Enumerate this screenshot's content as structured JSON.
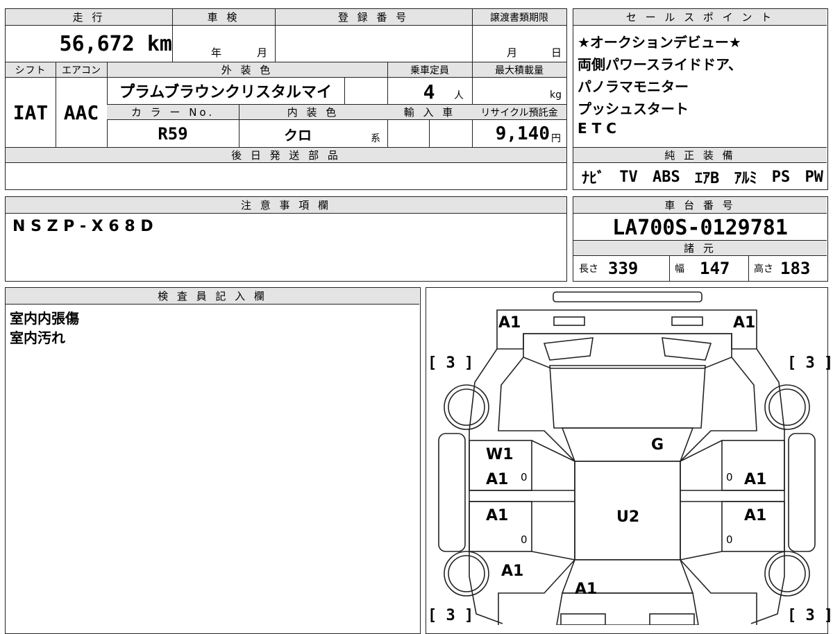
{
  "vehicle": {
    "mileage_header": "走 行",
    "mileage_value": "56,672 km",
    "inspection_header": "車 検",
    "inspection_year": "年",
    "inspection_month": "月",
    "registration_header": "登 録 番 号",
    "transfer_header": "譲渡書類期限",
    "transfer_month": "月",
    "transfer_day": "日",
    "shift_header": "シフト",
    "shift_value": "IAT",
    "ac_header": "エアコン",
    "ac_value": "AAC",
    "exterior_header": "外 装 色",
    "exterior_value": "プ゚ラムブ゙ラウンクリスタルマイ",
    "capacity_header": "乗車定員",
    "capacity_value": "4",
    "capacity_unit": "人",
    "load_header": "最大積載量",
    "load_unit": "kg",
    "color_no_header": "カ ラ ー No.",
    "color_no_value": "R59",
    "interior_header": "内 装 色",
    "interior_value": "クロ",
    "interior_suffix": "系",
    "import_header": "輸 入 車",
    "recycle_header": "リサイクル預託金",
    "recycle_value": "9,140",
    "recycle_unit": "円",
    "later_parts_header": "後 日 発 送 部 品"
  },
  "sales_points": {
    "header": "セ ー ル ス ポ イ ン ト",
    "lines": [
      "★オークションデビュー★",
      "両側パワースライドドア、",
      "パノラマモニター",
      "プッシュスタート",
      "E T C"
    ]
  },
  "equipment": {
    "header": "純 正 装 備",
    "items": [
      "ﾅﾋﾞ",
      "TV",
      "ABS",
      "ｴｱB",
      "ｱﾙﾐ",
      "PS",
      "PW"
    ]
  },
  "notes": {
    "header": "注 意 事 項 欄",
    "value": "N S Z P - X 6 8 D"
  },
  "chassis": {
    "header": "車 台 番 号",
    "value": "LA700S-0129781",
    "spec_header": "諸 元",
    "length_label": "長さ",
    "length_value": "339",
    "width_label": "幅",
    "width_value": "147",
    "height_label": "高さ",
    "height_value": "183"
  },
  "inspector": {
    "header": "検 査 員 記 入 欄",
    "lines": [
      "室内内張傷",
      "室内汚れ"
    ]
  },
  "damage_map": {
    "marks": {
      "front_left": "A1",
      "front_right": "A1",
      "bracket_tl": "[ 3 ]",
      "bracket_tr": "[ 3 ]",
      "bracket_bl": "[ 3 ]",
      "bracket_br": "[ 3 ]",
      "left_front_door_1": "W1",
      "left_front_door_2": "A1",
      "left_rear_door": "A1",
      "right_front_door": "A1",
      "right_rear_door": "A1",
      "windshield": "G",
      "roof": "U2",
      "left_rear_fender": "A1",
      "rear": "A1",
      "zero_lf": "0",
      "zero_lr": "0",
      "zero_rf": "0",
      "zero_rr": "0"
    }
  }
}
